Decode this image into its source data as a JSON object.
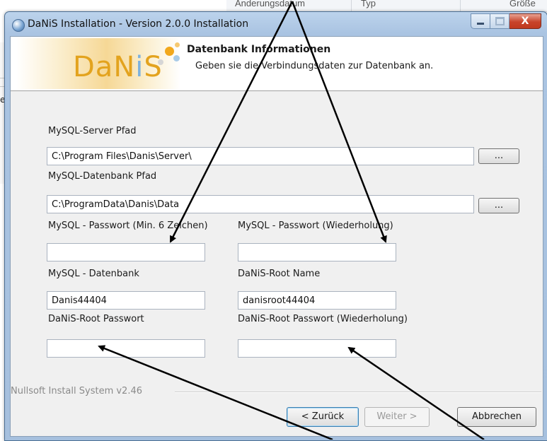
{
  "background": {
    "columns": [
      "Änderungsdatum",
      "Typ",
      "Größe"
    ],
    "left_text": "er"
  },
  "window": {
    "title": "DaNiS Installation - Version 2.0.0 Installation",
    "controls": {
      "close": "X"
    }
  },
  "header": {
    "logo_text_a": "Da",
    "logo_text_b": "N",
    "logo_text_c": "i",
    "logo_text_d": "S",
    "title": "Datenbank Informationen",
    "subtitle": "Geben sie die Verbindungsdaten zur Datenbank an."
  },
  "form": {
    "server_path_label": "MySQL-Server Pfad",
    "server_path_value": "C:\\Program Files\\Danis\\Server\\",
    "db_path_label": "MySQL-Datenbank Pfad",
    "db_path_value": "C:\\ProgramData\\Danis\\Data",
    "browse_label": "...",
    "password_label": "MySQL - Passwort (Min. 6 Zeichen)",
    "password_value": "",
    "password_repeat_label": "MySQL - Passwort (Wiederholung)",
    "password_repeat_value": "",
    "database_label": "MySQL - Datenbank",
    "database_value": "Danis44404",
    "root_name_label": "DaNiS-Root Name",
    "root_name_value": "danisroot44404",
    "root_password_label": "DaNiS-Root Passwort",
    "root_password_value": "",
    "root_password_repeat_label": "DaNiS-Root Passwort (Wiederholung)",
    "root_password_repeat_value": ""
  },
  "footer": {
    "branding": "Nullsoft Install System v2.46",
    "back_label": "< Zurück",
    "next_label": "Weiter >",
    "cancel_label": "Abbrechen"
  },
  "colors": {
    "accent": "#e3a31e",
    "arrow": "#000000",
    "close_button": "#c8442b"
  }
}
